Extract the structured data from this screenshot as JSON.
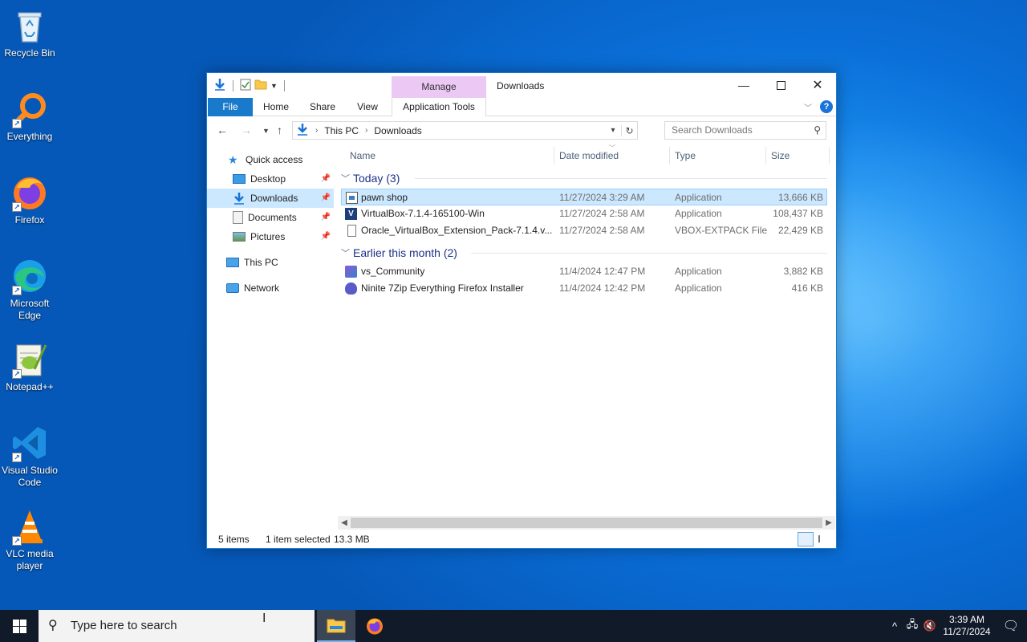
{
  "desktop": {
    "icons": [
      {
        "label": "Recycle Bin",
        "icon": "recycle-bin-icon"
      },
      {
        "label": "Everything",
        "icon": "everything-search-icon"
      },
      {
        "label": "Firefox",
        "icon": "firefox-icon"
      },
      {
        "label": "Microsoft Edge",
        "icon": "edge-icon"
      },
      {
        "label": "Notepad++",
        "icon": "notepadpp-icon"
      },
      {
        "label": "Visual Studio Code",
        "icon": "vscode-icon"
      },
      {
        "label": "VLC media player",
        "icon": "vlc-icon"
      }
    ]
  },
  "window": {
    "title": "Downloads",
    "manage_label": "Manage",
    "tabs": {
      "file": "File",
      "home": "Home",
      "share": "Share",
      "view": "View",
      "app_tools": "Application Tools"
    },
    "address": {
      "crumbs": [
        "This PC",
        "Downloads"
      ]
    },
    "search_placeholder": "Search Downloads",
    "nav_pane": {
      "quick_access": "Quick access",
      "pinned": [
        "Desktop",
        "Downloads",
        "Documents",
        "Pictures"
      ],
      "this_pc": "This PC",
      "network": "Network"
    },
    "columns": {
      "name": "Name",
      "date": "Date modified",
      "type": "Type",
      "size": "Size"
    },
    "groups": [
      {
        "title": "Today (3)",
        "rows": [
          {
            "name": "pawn shop",
            "date": "11/27/2024 3:29 AM",
            "type": "Application",
            "size": "13,666 KB",
            "icon": "app-window-icon"
          },
          {
            "name": "VirtualBox-7.1.4-165100-Win",
            "date": "11/27/2024 2:58 AM",
            "type": "Application",
            "size": "108,437 KB",
            "icon": "virtualbox-icon"
          },
          {
            "name": "Oracle_VirtualBox_Extension_Pack-7.1.4.v...",
            "date": "11/27/2024 2:58 AM",
            "type": "VBOX-EXTPACK File",
            "size": "22,429 KB",
            "icon": "blank-file-icon"
          }
        ]
      },
      {
        "title": "Earlier this month (2)",
        "rows": [
          {
            "name": "vs_Community",
            "date": "11/4/2024 12:47 PM",
            "type": "Application",
            "size": "3,882 KB",
            "icon": "visual-studio-installer-icon"
          },
          {
            "name": "Ninite 7Zip Everything Firefox Installer",
            "date": "11/4/2024 12:42 PM",
            "type": "Application",
            "size": "416 KB",
            "icon": "ninite-icon"
          }
        ]
      }
    ],
    "status": {
      "items": "5 items",
      "selected": "1 item selected",
      "size": "13.3 MB"
    }
  },
  "taskbar": {
    "search_placeholder": "Type here to search",
    "clock_time": "3:39 AM",
    "clock_date": "11/27/2024"
  }
}
